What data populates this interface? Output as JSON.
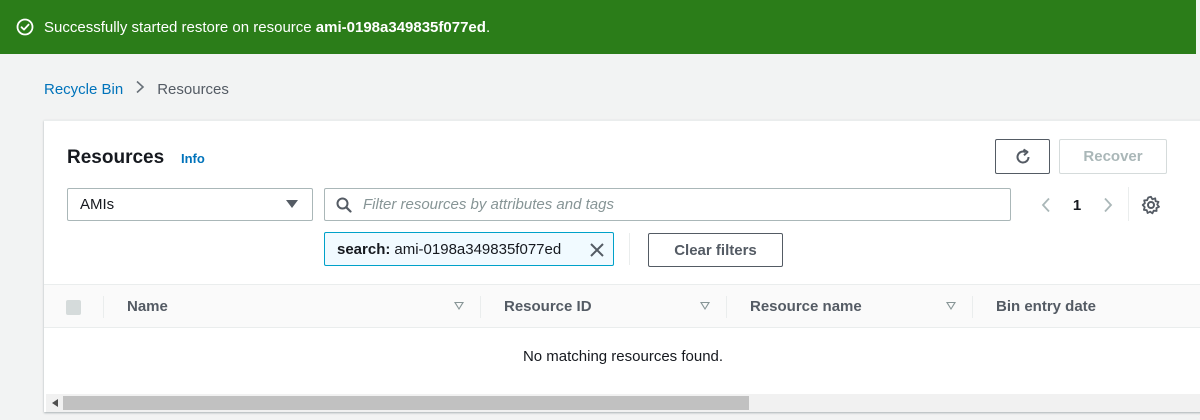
{
  "flash": {
    "message_prefix": "Successfully started restore on resource ",
    "resource_id": "ami-0198a349835f077ed",
    "suffix": ".",
    "bg_color": "#2b7d19"
  },
  "breadcrumb": {
    "root": "Recycle Bin",
    "current": "Resources"
  },
  "panel": {
    "title": "Resources",
    "info_link": "Info",
    "refresh_icon": "refresh-icon",
    "recover_label": "Recover"
  },
  "filters": {
    "resource_type": "AMIs",
    "search_placeholder": "Filter resources by attributes and tags",
    "search_value": "",
    "token_key": "search:",
    "token_value": "ami-0198a349835f077ed",
    "clear_label": "Clear filters"
  },
  "pagination": {
    "page": "1"
  },
  "table": {
    "columns": [
      "Name",
      "Resource ID",
      "Resource name",
      "Bin entry date"
    ],
    "empty_message": "No matching resources found."
  },
  "colors": {
    "link": "#0073bb",
    "token_border": "#00a1c9"
  }
}
